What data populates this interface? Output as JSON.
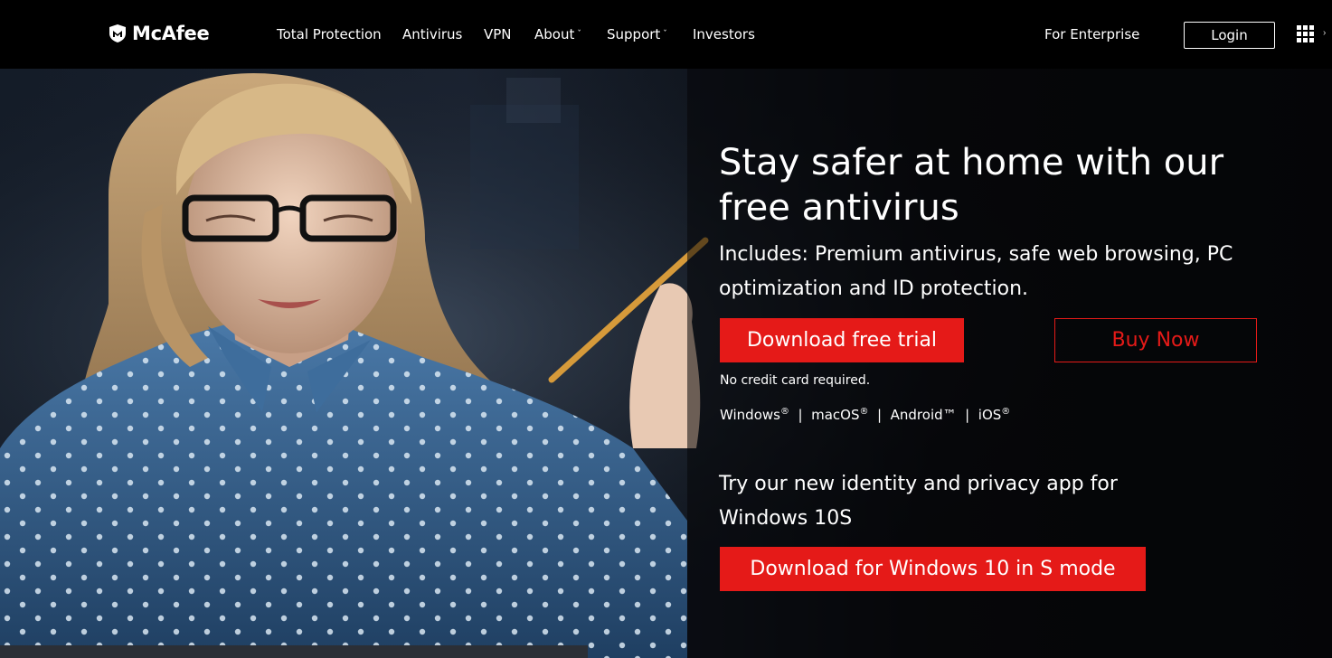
{
  "brand": {
    "name": "McAfee",
    "logo_icon": "shield-m-icon"
  },
  "nav": {
    "items": [
      {
        "label": "Total Protection",
        "dropdown": false
      },
      {
        "label": "Antivirus",
        "dropdown": false
      },
      {
        "label": "VPN",
        "dropdown": false
      },
      {
        "label": "About",
        "dropdown": true
      },
      {
        "label": "Support",
        "dropdown": true
      },
      {
        "label": "Investors",
        "dropdown": false
      }
    ],
    "enterprise": "For Enterprise",
    "login": "Login",
    "apps_icon": "grid-icon"
  },
  "hero": {
    "headline": "Stay safer at home with our free antivirus",
    "subhead": "Includes: Premium antivirus, safe web browsing, PC optimization and ID protection.",
    "trial_button": "Download free trial",
    "buy_button": "Buy Now",
    "note": "No credit card required.",
    "platforms": [
      "Windows",
      "macOS",
      "Android™",
      "iOS"
    ],
    "promo": "Try our new identity and privacy app for Windows 10S",
    "promo_button": "Download for Windows 10 in S mode"
  },
  "colors": {
    "accent": "#e51a18",
    "topbar": "#000000",
    "text": "#ffffff"
  }
}
